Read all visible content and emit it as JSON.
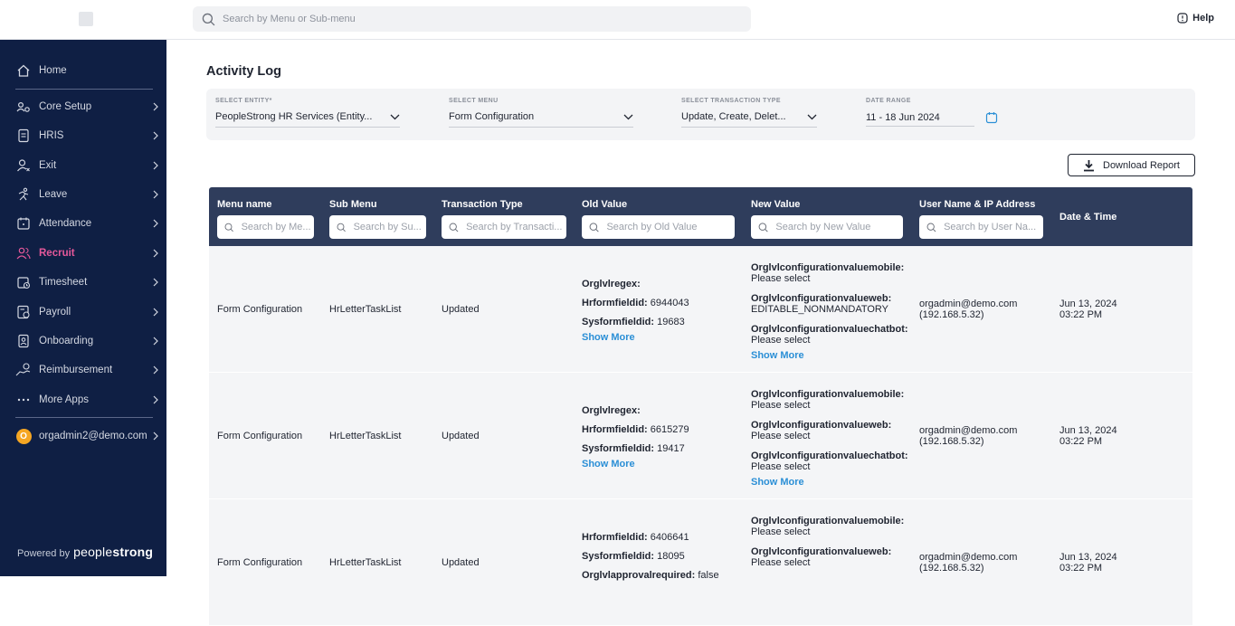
{
  "header": {
    "search_placeholder": "Search by Menu or Sub-menu",
    "help_label": "Help"
  },
  "sidebar": {
    "items": [
      {
        "label": "Home",
        "icon": "home-icon"
      },
      {
        "label": "Core Setup",
        "icon": "core-setup-icon"
      },
      {
        "label": "HRIS",
        "icon": "document-icon"
      },
      {
        "label": "Exit",
        "icon": "user-exit-icon"
      },
      {
        "label": "Leave",
        "icon": "running-icon"
      },
      {
        "label": "Attendance",
        "icon": "calendar-icon"
      },
      {
        "label": "Recruit",
        "icon": "users-icon"
      },
      {
        "label": "Timesheet",
        "icon": "timesheet-icon"
      },
      {
        "label": "Payroll",
        "icon": "payroll-icon"
      },
      {
        "label": "Onboarding",
        "icon": "badge-icon"
      },
      {
        "label": "Reimbursement",
        "icon": "hand-coin-icon"
      },
      {
        "label": "More Apps",
        "icon": "more-dots-icon"
      }
    ],
    "active_item": "Recruit",
    "user_initial": "O",
    "user_email": "orgadmin2@demo.com",
    "powered_by": "Powered by",
    "brand_light": "people",
    "brand_bold": "strong"
  },
  "page": {
    "title": "Activity Log",
    "filters": [
      {
        "label": "SELECT ENTITY*",
        "value": "PeopleStrong HR Services (Entity..."
      },
      {
        "label": "SELECT MENU",
        "value": "Form Configuration"
      },
      {
        "label": "SELECT TRANSACTION TYPE",
        "value": "Update, Create, Delet..."
      },
      {
        "label": "DATE RANGE",
        "value": "11 - 18 Jun 2024"
      }
    ],
    "download_label": "Download Report"
  },
  "table": {
    "columns": [
      {
        "label": "Menu name",
        "placeholder": "Search by Me..."
      },
      {
        "label": "Sub Menu",
        "placeholder": "Search by Su..."
      },
      {
        "label": "Transaction Type",
        "placeholder": "Search by Transacti..."
      },
      {
        "label": "Old Value",
        "placeholder": "Search by Old Value"
      },
      {
        "label": "New Value",
        "placeholder": "Search by New Value"
      },
      {
        "label": "User Name & IP Address",
        "placeholder": "Search by User Na..."
      },
      {
        "label": "Date & Time",
        "placeholder": ""
      }
    ],
    "show_more": "Show More",
    "rows": [
      {
        "menu": "Form Configuration",
        "submenu": "HrLetterTaskList",
        "transaction": "Updated",
        "old": [
          {
            "key": "Orglvlregex:",
            "val": ""
          },
          {
            "key": "Hrformfieldid:",
            "val": " 6944043"
          },
          {
            "key": "Sysformfieldid:",
            "val": " 19683"
          }
        ],
        "new": [
          {
            "key": "Orglvlconfigurationvaluemobile:",
            "val": "Please select"
          },
          {
            "key": "Orglvlconfigurationvalueweb:",
            "val": "EDITABLE_NONMANDATORY"
          },
          {
            "key": "Orglvlconfigurationvaluechatbot:",
            "val": "Please select"
          }
        ],
        "user": "orgadmin@demo.com",
        "ip": "(192.168.5.32)",
        "date": "Jun 13, 2024",
        "time": "03:22 PM"
      },
      {
        "menu": "Form Configuration",
        "submenu": "HrLetterTaskList",
        "transaction": "Updated",
        "old": [
          {
            "key": "Orglvlregex:",
            "val": ""
          },
          {
            "key": "Hrformfieldid:",
            "val": " 6615279"
          },
          {
            "key": "Sysformfieldid:",
            "val": " 19417"
          }
        ],
        "new": [
          {
            "key": "Orglvlconfigurationvaluemobile:",
            "val": "Please select"
          },
          {
            "key": "Orglvlconfigurationvalueweb:",
            "val": "Please select"
          },
          {
            "key": "Orglvlconfigurationvaluechatbot:",
            "val": "Please select"
          }
        ],
        "user": "orgadmin@demo.com",
        "ip": "(192.168.5.32)",
        "date": "Jun 13, 2024",
        "time": "03:22 PM"
      },
      {
        "menu": "Form Configuration",
        "submenu": "HrLetterTaskList",
        "transaction": "Updated",
        "old": [
          {
            "key": "Hrformfieldid:",
            "val": " 6406641"
          },
          {
            "key": "Sysformfieldid:",
            "val": " 18095"
          },
          {
            "key": "Orglvlapprovalrequired:",
            "val": " false"
          }
        ],
        "new": [
          {
            "key": "Orglvlconfigurationvaluemobile:",
            "val": "Please select"
          },
          {
            "key": "Orglvlconfigurationvalueweb:",
            "val": "Please select"
          }
        ],
        "user": "orgadmin@demo.com",
        "ip": "(192.168.5.32)",
        "date": "Jun 13, 2024",
        "time": "03:22 PM"
      }
    ]
  }
}
